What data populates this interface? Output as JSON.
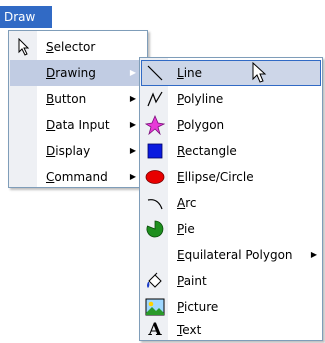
{
  "menubar": {
    "title": "Draw"
  },
  "draw_menu": {
    "items": [
      {
        "label": "Selector",
        "icon": "cursor-arrow-icon",
        "has_submenu": false
      },
      {
        "label": "Drawing",
        "icon": "",
        "has_submenu": true
      },
      {
        "label": "Button",
        "icon": "",
        "has_submenu": true
      },
      {
        "label": "Data Input",
        "icon": "",
        "has_submenu": true
      },
      {
        "label": "Display",
        "icon": "",
        "has_submenu": true
      },
      {
        "label": "Command",
        "icon": "",
        "has_submenu": true
      }
    ]
  },
  "drawing_submenu": {
    "items": [
      {
        "label": "Line",
        "icon": "line-icon",
        "has_submenu": false
      },
      {
        "label": "Polyline",
        "icon": "polyline-icon",
        "has_submenu": false
      },
      {
        "label": "Polygon",
        "icon": "polygon-icon",
        "has_submenu": false
      },
      {
        "label": "Rectangle",
        "icon": "rectangle-icon",
        "has_submenu": false
      },
      {
        "label": "Ellipse/Circle",
        "icon": "ellipse-icon",
        "has_submenu": false
      },
      {
        "label": "Arc",
        "icon": "arc-icon",
        "has_submenu": false
      },
      {
        "label": "Pie",
        "icon": "pie-icon",
        "has_submenu": false
      },
      {
        "label": "Equilateral Polygon",
        "icon": "",
        "has_submenu": true
      },
      {
        "label": "Paint",
        "icon": "paint-bucket-icon",
        "has_submenu": false
      },
      {
        "label": "Picture",
        "icon": "picture-icon",
        "has_submenu": false
      },
      {
        "label": "Text",
        "icon": "text-icon",
        "has_submenu": false
      }
    ]
  },
  "colors": {
    "menubar_highlight": "#316ac5",
    "selection_fill": "#cdd6e8",
    "gutter": "#eef0f4",
    "polygon": "#e83ad8",
    "rectangle": "#0a1adf",
    "ellipse": "#e80000",
    "pie": "#1e8f1e"
  }
}
